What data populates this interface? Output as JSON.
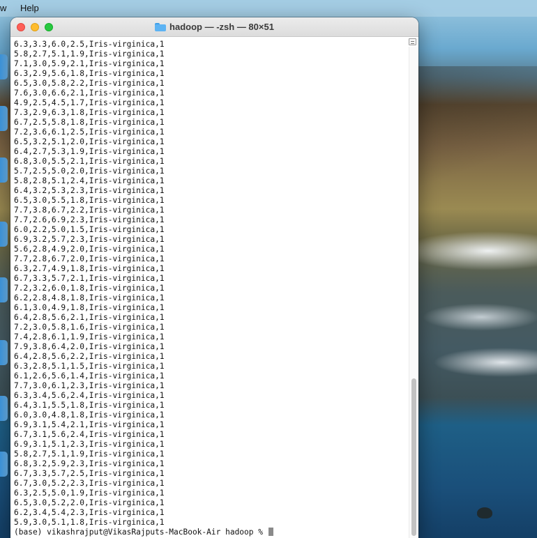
{
  "menubar": {
    "items": [
      "w",
      "Help"
    ]
  },
  "window": {
    "title": "hadoop — -zsh — 80×51"
  },
  "terminal": {
    "lines": [
      "6.3,3.3,6.0,2.5,Iris-virginica,1",
      "5.8,2.7,5.1,1.9,Iris-virginica,1",
      "7.1,3.0,5.9,2.1,Iris-virginica,1",
      "6.3,2.9,5.6,1.8,Iris-virginica,1",
      "6.5,3.0,5.8,2.2,Iris-virginica,1",
      "7.6,3.0,6.6,2.1,Iris-virginica,1",
      "4.9,2.5,4.5,1.7,Iris-virginica,1",
      "7.3,2.9,6.3,1.8,Iris-virginica,1",
      "6.7,2.5,5.8,1.8,Iris-virginica,1",
      "7.2,3.6,6.1,2.5,Iris-virginica,1",
      "6.5,3.2,5.1,2.0,Iris-virginica,1",
      "6.4,2.7,5.3,1.9,Iris-virginica,1",
      "6.8,3.0,5.5,2.1,Iris-virginica,1",
      "5.7,2.5,5.0,2.0,Iris-virginica,1",
      "5.8,2.8,5.1,2.4,Iris-virginica,1",
      "6.4,3.2,5.3,2.3,Iris-virginica,1",
      "6.5,3.0,5.5,1.8,Iris-virginica,1",
      "7.7,3.8,6.7,2.2,Iris-virginica,1",
      "7.7,2.6,6.9,2.3,Iris-virginica,1",
      "6.0,2.2,5.0,1.5,Iris-virginica,1",
      "6.9,3.2,5.7,2.3,Iris-virginica,1",
      "5.6,2.8,4.9,2.0,Iris-virginica,1",
      "7.7,2.8,6.7,2.0,Iris-virginica,1",
      "6.3,2.7,4.9,1.8,Iris-virginica,1",
      "6.7,3.3,5.7,2.1,Iris-virginica,1",
      "7.2,3.2,6.0,1.8,Iris-virginica,1",
      "6.2,2.8,4.8,1.8,Iris-virginica,1",
      "6.1,3.0,4.9,1.8,Iris-virginica,1",
      "6.4,2.8,5.6,2.1,Iris-virginica,1",
      "7.2,3.0,5.8,1.6,Iris-virginica,1",
      "7.4,2.8,6.1,1.9,Iris-virginica,1",
      "7.9,3.8,6.4,2.0,Iris-virginica,1",
      "6.4,2.8,5.6,2.2,Iris-virginica,1",
      "6.3,2.8,5.1,1.5,Iris-virginica,1",
      "6.1,2.6,5.6,1.4,Iris-virginica,1",
      "7.7,3.0,6.1,2.3,Iris-virginica,1",
      "6.3,3.4,5.6,2.4,Iris-virginica,1",
      "6.4,3.1,5.5,1.8,Iris-virginica,1",
      "6.0,3.0,4.8,1.8,Iris-virginica,1",
      "6.9,3.1,5.4,2.1,Iris-virginica,1",
      "6.7,3.1,5.6,2.4,Iris-virginica,1",
      "6.9,3.1,5.1,2.3,Iris-virginica,1",
      "5.8,2.7,5.1,1.9,Iris-virginica,1",
      "6.8,3.2,5.9,2.3,Iris-virginica,1",
      "6.7,3.3,5.7,2.5,Iris-virginica,1",
      "6.7,3.0,5.2,2.3,Iris-virginica,1",
      "6.3,2.5,5.0,1.9,Iris-virginica,1",
      "6.5,3.0,5.2,2.0,Iris-virginica,1",
      "6.2,3.4,5.4,2.3,Iris-virginica,1",
      "5.9,3.0,5.1,1.8,Iris-virginica,1"
    ],
    "prompt": "(base) vikashrajput@VikasRajputs-MacBook-Air hadoop % "
  },
  "icons": {
    "folder": "folder-icon",
    "close": "close-icon",
    "minimize": "minimize-icon",
    "zoom": "zoom-icon"
  },
  "colors": {
    "close": "#fe5f57",
    "minimize": "#febc2e",
    "zoom": "#28c840",
    "folder": "#5db3f3"
  }
}
